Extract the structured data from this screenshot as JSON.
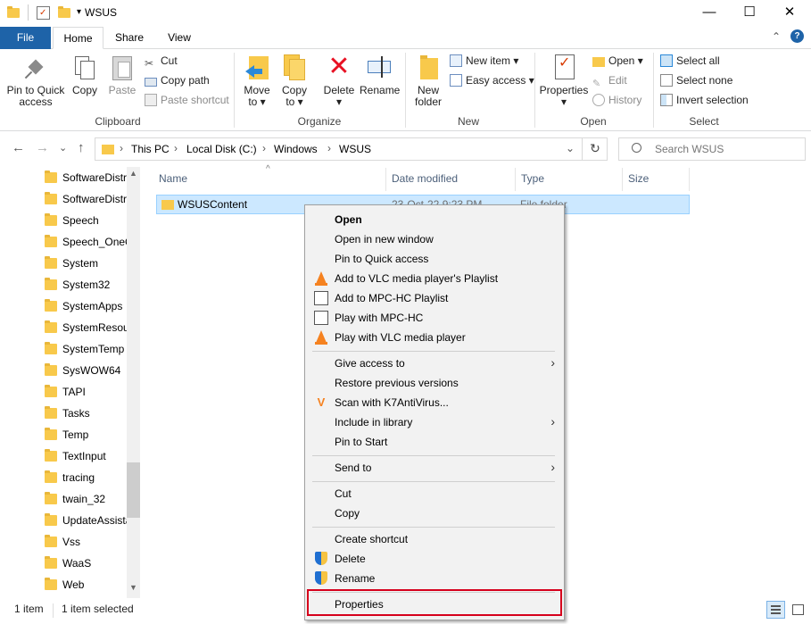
{
  "window": {
    "title": "WSUS",
    "minimize": "—",
    "maximize": "☐",
    "close": "✕"
  },
  "ribbon_tabs": [
    "File",
    "Home",
    "Share",
    "View"
  ],
  "ribbon": {
    "clipboard": {
      "label": "Clipboard",
      "pin": "Pin to Quick\naccess",
      "pin_l1": "Pin to Quick",
      "pin_l2": "access",
      "copy": "Copy",
      "paste": "Paste",
      "cut": "Cut",
      "copy_path": "Copy path",
      "paste_shortcut": "Paste shortcut"
    },
    "organize": {
      "label": "Organize",
      "move_to": "Move",
      "move_to_2": "to ▾",
      "copy_to": "Copy",
      "copy_to_2": "to ▾",
      "delete": "Delete",
      "delete_2": "▾",
      "rename": "Rename"
    },
    "new": {
      "label": "New",
      "new_folder_1": "New",
      "new_folder_2": "folder",
      "new_item": "New item ▾",
      "easy_access": "Easy access ▾"
    },
    "open": {
      "label": "Open",
      "properties": "Properties",
      "properties_2": "▾",
      "open": "Open ▾",
      "edit": "Edit",
      "history": "History"
    },
    "select": {
      "label": "Select",
      "select_all": "Select all",
      "select_none": "Select none",
      "invert_selection": "Invert selection"
    },
    "collapse": "⌃",
    "help": "?"
  },
  "address": {
    "back": "←",
    "forward": "→",
    "recent": "⌄",
    "up": "↑",
    "crumbs": [
      "This PC",
      "Local Disk (C:)",
      "Windows",
      "WSUS"
    ],
    "sep": "›",
    "dropdown": "⌄",
    "refresh": "↻",
    "search_placeholder": "Search WSUS"
  },
  "nav_pane": [
    "SoftwareDistr",
    "SoftwareDistr",
    "Speech",
    "Speech_OneC",
    "System",
    "System32",
    "SystemApps",
    "SystemResou",
    "SystemTemp",
    "SysWOW64",
    "TAPI",
    "Tasks",
    "Temp",
    "TextInput",
    "tracing",
    "twain_32",
    "UpdateAssista",
    "Vss",
    "WaaS",
    "Web"
  ],
  "columns": {
    "name": "Name",
    "date_modified": "Date modified",
    "type": "Type",
    "size": "Size",
    "sort_arrow": "^"
  },
  "files": [
    {
      "name": "WSUSContent",
      "date": "23-Oct-22 9:23 PM",
      "type": "File folder"
    }
  ],
  "context_menu": {
    "open": "Open",
    "open_new_window": "Open in new window",
    "pin_quick": "Pin to Quick access",
    "vlc_playlist": "Add to VLC media player's Playlist",
    "mpc_playlist": "Add to MPC-HC Playlist",
    "play_mpc": "Play with MPC-HC",
    "play_vlc": "Play with VLC media player",
    "give_access": "Give access to",
    "restore": "Restore previous versions",
    "scan": "Scan with K7AntiVirus...",
    "include_library": "Include in library",
    "pin_start": "Pin to Start",
    "send_to": "Send to",
    "cut": "Cut",
    "copy": "Copy",
    "create_shortcut": "Create shortcut",
    "delete": "Delete",
    "rename": "Rename",
    "properties": "Properties",
    "submenu_arrow": "›"
  },
  "status": {
    "items": "1 item",
    "selected": "1 item selected"
  },
  "colors": {
    "file_tab": "#1e63a8",
    "selection": "#cce8ff",
    "highlight_box": "#d6001c",
    "folder": "#f8c94b"
  }
}
